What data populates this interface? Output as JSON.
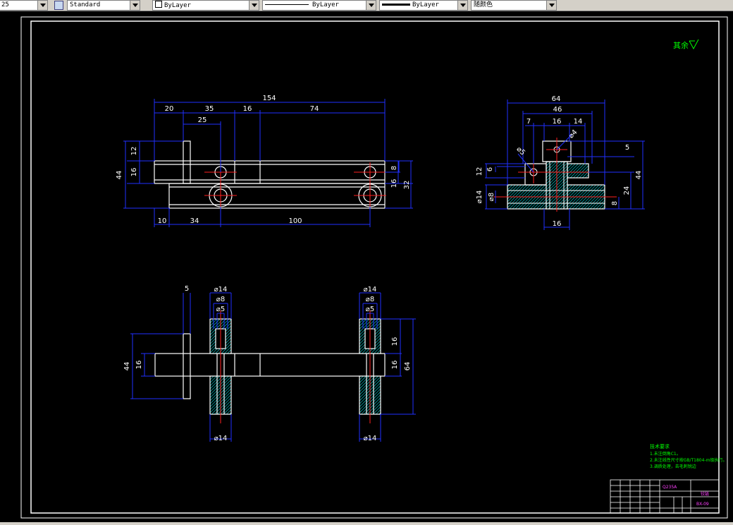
{
  "toolbar": {
    "scale_value": "25",
    "text_style": "Standard",
    "layer": "ByLayer",
    "linetype": "ByLayer",
    "lineweight": "ByLayer",
    "plot_style": "随颜色"
  },
  "drawing": {
    "roughness_note": "其余",
    "notes_title": "技术要求",
    "notes": [
      "1.未注倒角C1。",
      "2.未注线性尺寸按GB/T1804-m级执行。",
      "3.调质处理，去毛刺锐边"
    ],
    "title_block": {
      "material": "Q235A",
      "name": "铰链",
      "drawing_no": "BX-09"
    },
    "dim": {
      "top": {
        "overall": "154",
        "s20": "20",
        "s35": "35",
        "s16": "16",
        "s74": "74",
        "s25": "25",
        "l44": "44",
        "l12": "12",
        "l16": "16",
        "r8": "8",
        "r16": "16",
        "r32": "32",
        "b10": "10",
        "b34": "34",
        "b100": "100"
      },
      "side": {
        "w64": "64",
        "w46": "46",
        "w7": "7",
        "w16": "16",
        "w14": "14",
        "d4": "⌀4",
        "d5": "⌀5",
        "r5": "5",
        "l12": "12",
        "l6": "6",
        "ld14": "⌀14",
        "ld8": "⌀8",
        "r24": "24",
        "r44": "44",
        "r8": "8",
        "b16": "16"
      },
      "bottom": {
        "t5": "5",
        "d14a": "⌀14",
        "d8a": "⌀8",
        "d5a": "⌀5",
        "d14b": "⌀14",
        "d8b": "⌀8",
        "d5b": "⌀5",
        "l44": "44",
        "l16": "16",
        "r16a": "16",
        "r16b": "16",
        "r64": "64",
        "bd14a": "⌀14",
        "bd14b": "⌀14"
      }
    }
  }
}
